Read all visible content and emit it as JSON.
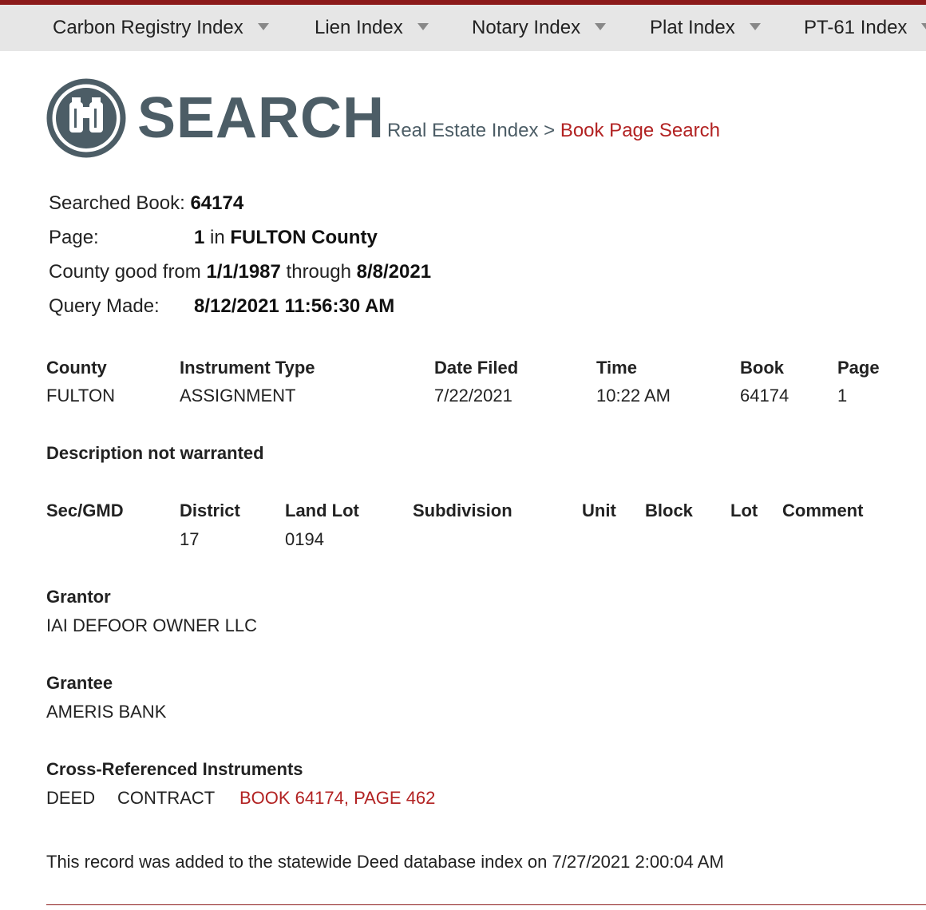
{
  "nav": {
    "items": [
      {
        "label": "Carbon Registry Index"
      },
      {
        "label": "Lien Index"
      },
      {
        "label": "Notary Index"
      },
      {
        "label": "Plat Index"
      },
      {
        "label": "PT-61 Index"
      }
    ]
  },
  "header": {
    "title": "SEARCH",
    "breadcrumb_parent": "Real Estate Index",
    "breadcrumb_sep": ">",
    "breadcrumb_current": "Book Page Search"
  },
  "search_info": {
    "book_label": "Searched Book:",
    "book_value": "64174",
    "page_label": "Page:",
    "page_value": "1",
    "page_in": "in",
    "county_value": "FULTON County",
    "county_good_label": "County good from",
    "county_good_from": "1/1/1987",
    "county_good_through_label": "through",
    "county_good_through": "8/8/2021",
    "query_label": "Query Made:",
    "query_value": "8/12/2021 11:56:30 AM"
  },
  "record": {
    "headers": {
      "county": "County",
      "instrument_type": "Instrument Type",
      "date_filed": "Date Filed",
      "time": "Time",
      "book": "Book",
      "page": "Page"
    },
    "values": {
      "county": "FULTON",
      "instrument_type": "ASSIGNMENT",
      "date_filed": "7/22/2021",
      "time": "10:22 AM",
      "book": "64174",
      "page": "1"
    }
  },
  "description_note": "Description not warranted",
  "property": {
    "headers": {
      "sec_gmd": "Sec/GMD",
      "district": "District",
      "land_lot": "Land Lot",
      "subdivision": "Subdivision",
      "unit": "Unit",
      "block": "Block",
      "lot": "Lot",
      "comment": "Comment"
    },
    "values": {
      "district": "17",
      "land_lot": "0194"
    }
  },
  "grantor": {
    "label": "Grantor",
    "value": "IAI DEFOOR OWNER LLC"
  },
  "grantee": {
    "label": "Grantee",
    "value": "AMERIS BANK"
  },
  "cross_ref": {
    "label": "Cross-Referenced Instruments",
    "type1": "DEED",
    "type2": "CONTRACT",
    "link": "BOOK 64174, PAGE 462"
  },
  "footer_note": "This record was added to the statewide Deed database index on 7/27/2021 2:00:04 AM"
}
